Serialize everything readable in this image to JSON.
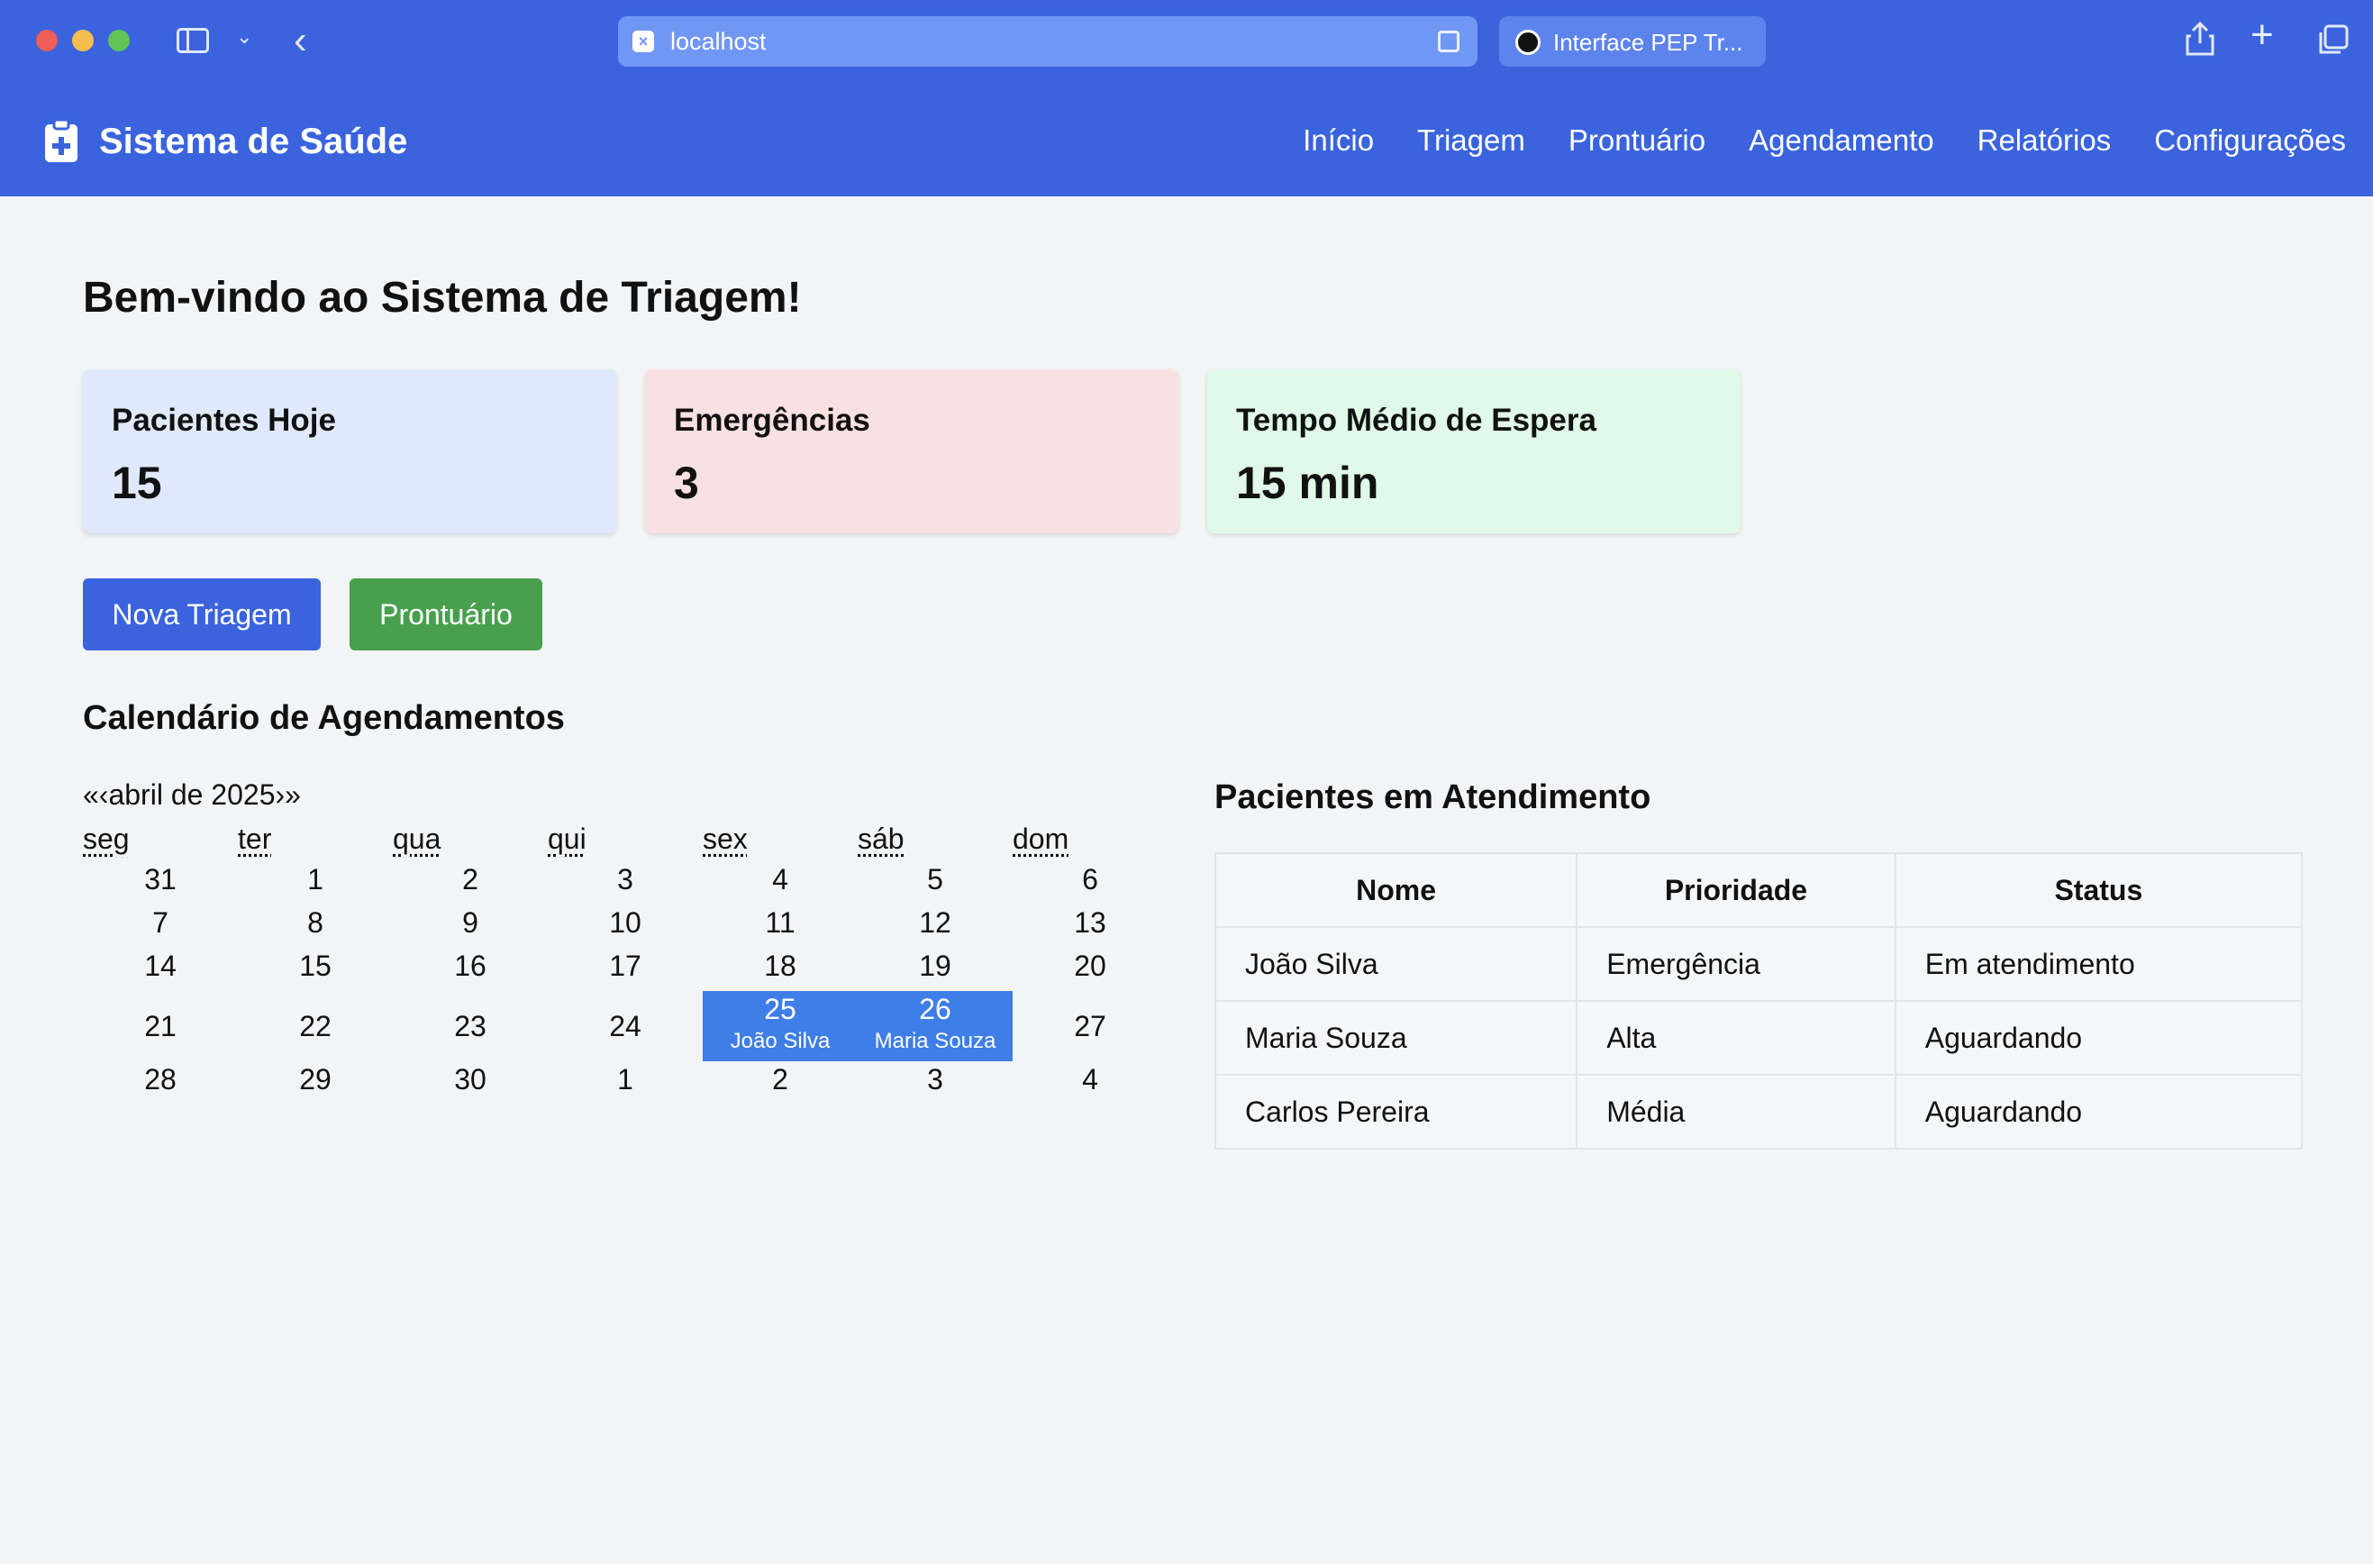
{
  "browser": {
    "url": "localhost",
    "tab_title": "Interface PEP Tr..."
  },
  "app": {
    "title": "Sistema de Saúde",
    "nav": [
      "Início",
      "Triagem",
      "Prontuário",
      "Agendamento",
      "Relatórios",
      "Configurações"
    ]
  },
  "main": {
    "welcome": "Bem-vindo ao Sistema de Triagem!",
    "stats": [
      {
        "label": "Pacientes Hoje",
        "value": "15",
        "color": "#e0e9fb"
      },
      {
        "label": "Emergências",
        "value": "3",
        "color": "#f9e1e1"
      },
      {
        "label": "Tempo Médio de Espera",
        "value": "15 min",
        "color": "#e0f9e8"
      }
    ],
    "buttons": {
      "new_triage": "Nova Triagem",
      "record": "Prontuário"
    }
  },
  "calendar": {
    "title": "Calendário de Agendamentos",
    "prev_year": "«",
    "prev_month": "‹",
    "month_label": "abril de 2025",
    "next_month": "›",
    "next_year": "»",
    "weekdays": [
      "seg",
      "ter",
      "qua",
      "qui",
      "sex",
      "sáb",
      "dom"
    ],
    "weeks": [
      [
        {
          "day": "31"
        },
        {
          "day": "1"
        },
        {
          "day": "2"
        },
        {
          "day": "3"
        },
        {
          "day": "4"
        },
        {
          "day": "5"
        },
        {
          "day": "6"
        }
      ],
      [
        {
          "day": "7"
        },
        {
          "day": "8"
        },
        {
          "day": "9"
        },
        {
          "day": "10"
        },
        {
          "day": "11"
        },
        {
          "day": "12"
        },
        {
          "day": "13"
        }
      ],
      [
        {
          "day": "14"
        },
        {
          "day": "15"
        },
        {
          "day": "16"
        },
        {
          "day": "17"
        },
        {
          "day": "18"
        },
        {
          "day": "19"
        },
        {
          "day": "20"
        }
      ],
      [
        {
          "day": "21"
        },
        {
          "day": "22"
        },
        {
          "day": "23"
        },
        {
          "day": "24"
        },
        {
          "day": "25",
          "event": "João Silva"
        },
        {
          "day": "26",
          "event": "Maria Souza"
        },
        {
          "day": "27"
        }
      ],
      [
        {
          "day": "28"
        },
        {
          "day": "29"
        },
        {
          "day": "30"
        },
        {
          "day": "1"
        },
        {
          "day": "2"
        },
        {
          "day": "3"
        },
        {
          "day": "4"
        }
      ]
    ],
    "event_color": "#3f7de8"
  },
  "patients": {
    "title": "Pacientes em Atendimento",
    "headers": [
      "Nome",
      "Prioridade",
      "Status"
    ],
    "rows": [
      [
        "João Silva",
        "Emergência",
        "Em atendimento"
      ],
      [
        "Maria Souza",
        "Alta",
        "Aguardando"
      ],
      [
        "Carlos Pereira",
        "Média",
        "Aguardando"
      ]
    ]
  },
  "colors": {
    "header": "#3a63dd",
    "primary_button": "#3a63dd",
    "success_button": "#48a04e"
  }
}
